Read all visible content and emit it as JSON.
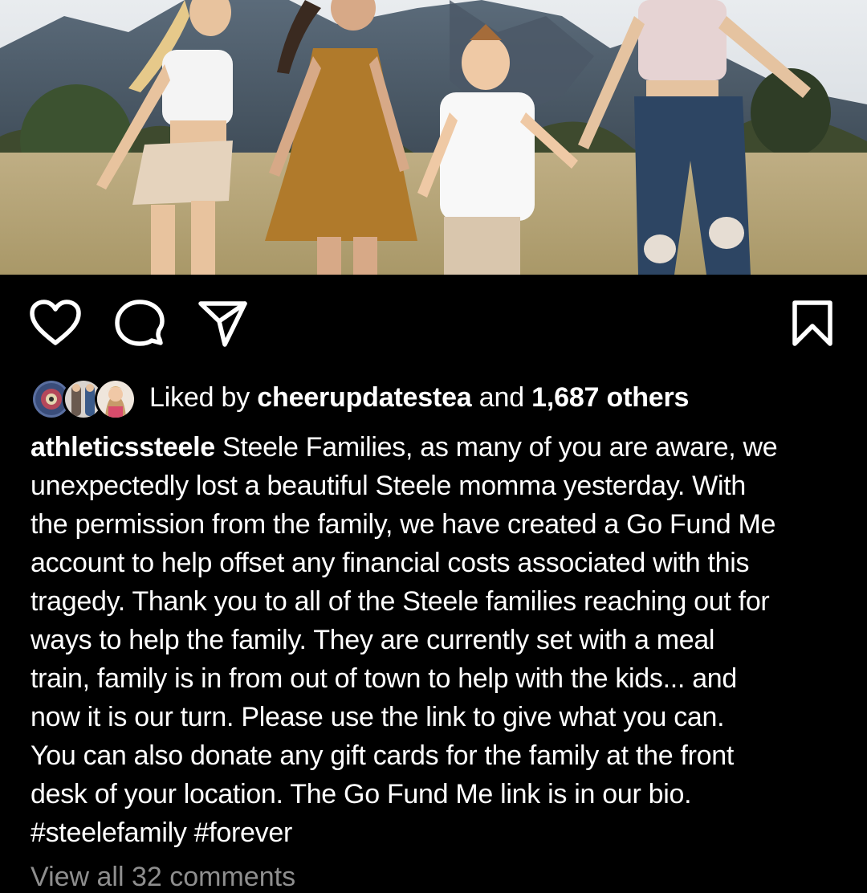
{
  "post": {
    "image_alt": "family-photo",
    "actions": {
      "like_icon": "heart-icon",
      "comment_icon": "comment-bubble-icon",
      "share_icon": "paper-plane-icon",
      "save_icon": "bookmark-icon"
    },
    "likes": {
      "prefix": "Liked by",
      "user": "cheerupdatestea",
      "connector": "and",
      "count": "1,687 others"
    },
    "caption": {
      "username": "athleticssteele",
      "first_line_text": "Steele Families, as many of you are aware, we",
      "lines": [
        "unexpectedly lost a beautiful Steele momma yesterday. With",
        "the permission from the family, we have created a Go Fund Me",
        "account to help offset any financial costs associated with this",
        "tragedy. Thank you to all of the Steele families reaching out for",
        "ways to help the family. They are currently set with a meal",
        "train, family is in from out of town to help with the kids... and",
        "now it is our turn. Please use the link to give what you can.",
        "You can also donate any gift cards for the family at the front",
        "desk of your location. The Go Fund Me link is in our bio.",
        "#steelefamily #forever"
      ]
    },
    "view_comments": "View all 32 comments"
  },
  "colors": {
    "background": "#000000",
    "text": "#ffffff",
    "muted": "#8e8e8e"
  }
}
